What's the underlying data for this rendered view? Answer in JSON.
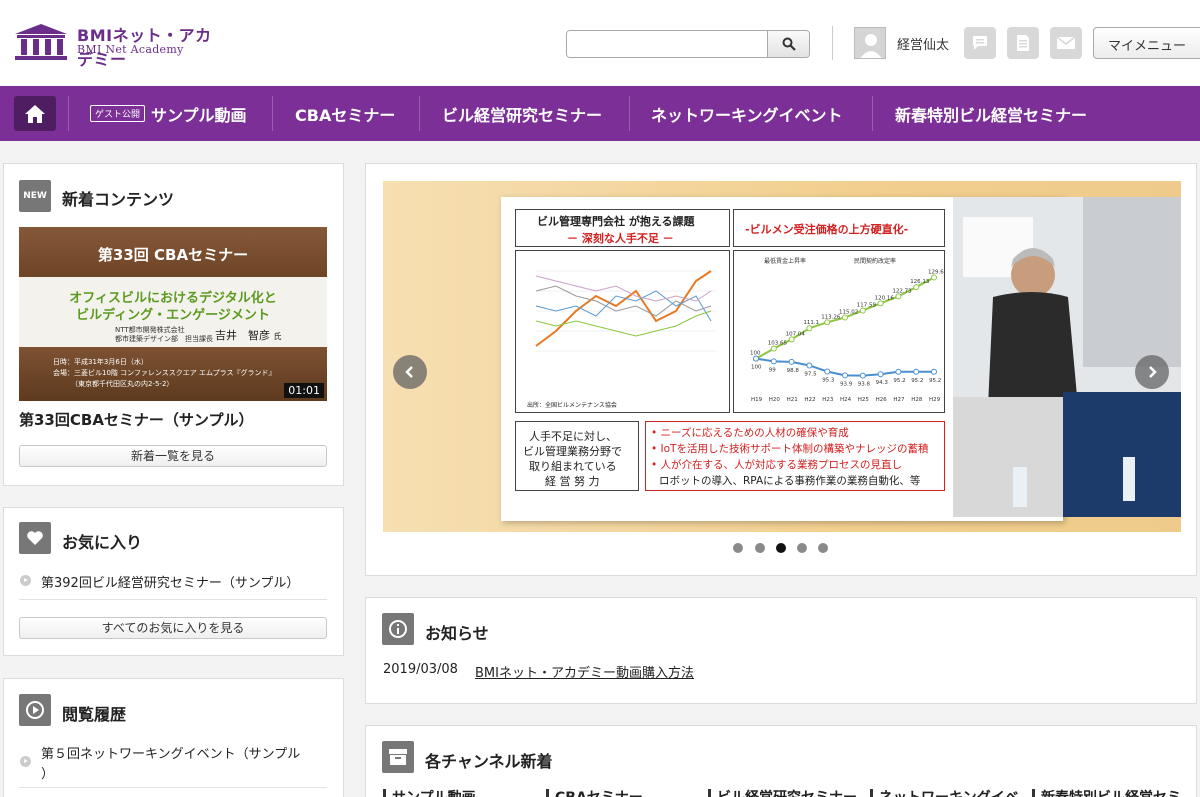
{
  "header": {
    "logo_line1": "BMIネット・アカデミー",
    "logo_line2": "BMI Net Academy",
    "search_placeholder": "",
    "username": "経営仙太",
    "my_menu": "マイメニュー"
  },
  "nav": {
    "guest_badge": "ゲスト公開",
    "items": [
      "サンプル動画",
      "CBAセミナー",
      "ビル経営研究セミナー",
      "ネットワーキングイベント",
      "新春特別ビル経営セミナー"
    ]
  },
  "new_contents": {
    "title": "新着コンテンツ",
    "badge": "NEW",
    "thumb": {
      "title": "第33回 CBAセミナー",
      "subtitle1": "オフィスビルにおけるデジタル化と",
      "subtitle2": "ビルディング・エンゲージメント",
      "org1": "NTT都市開発株式会社",
      "org2": "都市建築デザイン部　担当課長",
      "speaker": "吉井　智彦",
      "honorific": "氏",
      "info1": "日時：平成31年3月6日（水）",
      "info2": "会場：三菱ビル10階 コンファレンススクエア エムプラス『グランド』",
      "info3": "（東京都千代田区丸の内2-5-2）",
      "duration": "01:01"
    },
    "item_title": "第33回CBAセミナー（サンプル）",
    "more_button": "新着一覧を見る"
  },
  "favorites": {
    "title": "お気に入り",
    "items": [
      "第392回ビル経営研究セミナー（サンプル）"
    ],
    "more_button": "すべてのお気に入りを見る"
  },
  "history": {
    "title": "閲覧履歴",
    "items": [
      "第５回ネットワーキングイベント（サンプル",
      "）"
    ]
  },
  "carousel": {
    "slide": {
      "box1_line1": "ビル管理専門会社 が抱える課題",
      "box1_line2": "－ 深刻な人手不足 －",
      "box2_title": "-ビルメン受注価格の上方硬直化-",
      "legend1": "最低賃金上昇率",
      "legend2": "民間契約改定率",
      "source": "出所：全国ビルメンテナンス協会",
      "left_text": [
        "人手不足に対し、",
        "ビル管理業務分野で",
        "取り組まれている",
        "経 営 努 力"
      ],
      "bullets": [
        "• ニーズに応えるための人材の確保や育成",
        "• IoTを活用した技術サポート体制の構築やナレッジの蓄積",
        "• 人が介在する、人が対応する業務プロセスの見直し",
        "ロボットの導入、RPAによる事務作業の業務自動化、等"
      ],
      "green_values": [
        "100",
        "103.65",
        "107.04",
        "111.1",
        "113.26",
        "115.02",
        "117.59",
        "120.16",
        "122.73",
        "126.13",
        "129.63"
      ],
      "blue_values": [
        "100",
        "99",
        "98.8",
        "97.5",
        "95.3",
        "93.9",
        "93.8",
        "94.3",
        "95.2",
        "95.2",
        "95.2"
      ],
      "years": [
        "H19",
        "H20",
        "H21",
        "H22",
        "H23",
        "H24",
        "H25",
        "H26",
        "H27",
        "H28",
        "H29"
      ]
    },
    "dots": 5,
    "active_dot": 2
  },
  "notices": {
    "title": "お知らせ",
    "items": [
      {
        "date": "2019/03/08",
        "text": "BMIネット・アカデミー動画購入方法"
      }
    ]
  },
  "channels": {
    "title": "各チャンネル新着",
    "tabs": [
      "サンプル動画",
      "CBAセミナー",
      "ビル経営研究セミナー",
      "ネットワーキングイベ",
      "新春特別ビル経営セミ"
    ]
  },
  "colors": {
    "brand_purple": "#7b2f97",
    "nav_dark": "#4e1d62",
    "green_line": "#8cc63f",
    "blue_line": "#4a8fd0",
    "orange_line": "#e87722"
  }
}
